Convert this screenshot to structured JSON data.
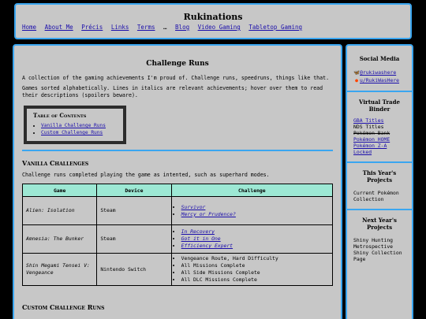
{
  "header": {
    "site_title": "Rukinations",
    "nav": {
      "home": "Home",
      "about": "About Me",
      "precis": "Précis",
      "links": "Links",
      "terms": "Terms",
      "sep": "…",
      "blog": "Blog",
      "video_gaming": "Video Gaming",
      "tabletop_gaming": "Tabletop Gaming"
    }
  },
  "main": {
    "title": "Challenge Runs",
    "intro": "A collection of the gaming achievements I'm proud of. Challenge runs, speedruns, things like that.",
    "intro2": "Games sorted alphabetically. Lines in italics are relevant achievements; hover over them to read their descriptions (spoilers beware).",
    "toc": {
      "title": "Table of Contents",
      "items": [
        "Vanilla Challenge Runs",
        "Custom Challenge Runs"
      ]
    },
    "vanilla": {
      "title": "Vanilla Challenges",
      "desc": "Challenge runs completed playing the game as intented, such as superhard modes.",
      "headers": [
        "Game",
        "Device",
        "Challenge"
      ],
      "rows": [
        {
          "game": "Alien: Isolation",
          "device": "Steam",
          "challenges": [
            "Survivor",
            "Mercy or Prudence?"
          ]
        },
        {
          "game": "Amnesia: The Bunker",
          "device": "Steam",
          "challenges": [
            "In Recovery",
            "Got it in One",
            "Efficiency Expert"
          ]
        },
        {
          "game": "Shin Megami Tensei V: Vengeance",
          "device": "Nintendo Switch",
          "challenges": [
            "Vengeance Route, Hard Difficulty",
            "All Missions Complete",
            "All Side Missions Complete",
            "All DLC Missions Complete"
          ]
        }
      ]
    },
    "custom": {
      "title": "Custom Challenge Runs"
    }
  },
  "sidebar": {
    "social": {
      "title": "Social Media",
      "bluesky": "@rukiwashere",
      "reddit": "u/RukiWasHere"
    },
    "binder": {
      "title": "Virtual Trade Binder",
      "gba": "GBA Titles",
      "nds": "NDS Titles",
      "pokemon_bank": "Pokémon Bank",
      "pokemon_home": "Pokémon HOME",
      "pokemon_za": "Pokémon Z-A",
      "locked": "Locked"
    },
    "this_year": {
      "title": "This Year's Projects",
      "text": "Current Pokémon Collection"
    },
    "next_year": {
      "title": "Next Year's Projects",
      "text": "Shiny Hunting Metrospective Shiny Collection Page"
    }
  }
}
